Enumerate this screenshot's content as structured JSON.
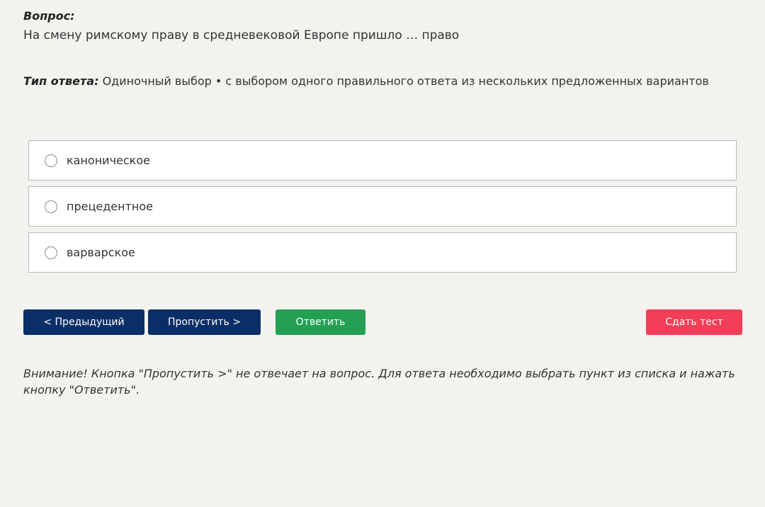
{
  "question": {
    "label": "Вопрос:",
    "text": "На смену римскому праву в средневековой Европе пришло … право"
  },
  "answer_type": {
    "label": "Тип ответа:",
    "value": "Одиночный выбор • с выбором одного правильного ответа из нескольких предложенных вариантов"
  },
  "options": [
    {
      "label": "каноническое",
      "selected": false
    },
    {
      "label": "прецедентное",
      "selected": false
    },
    {
      "label": "варварское",
      "selected": false
    }
  ],
  "buttons": {
    "prev": "< Предыдущий",
    "skip": "Пропустить >",
    "answer": "Ответить",
    "submit": "Сдать тест"
  },
  "colors": {
    "background": "#f3f2ef",
    "nav_button": "#0b2e66",
    "answer_button": "#23a052",
    "submit_button": "#f23e56"
  },
  "warning": "Внимание! Кнопка \"Пропустить >\" не отвечает на вопрос. Для ответа необходимо выбрать пункт из списка и нажать кнопку \"Ответить\"."
}
